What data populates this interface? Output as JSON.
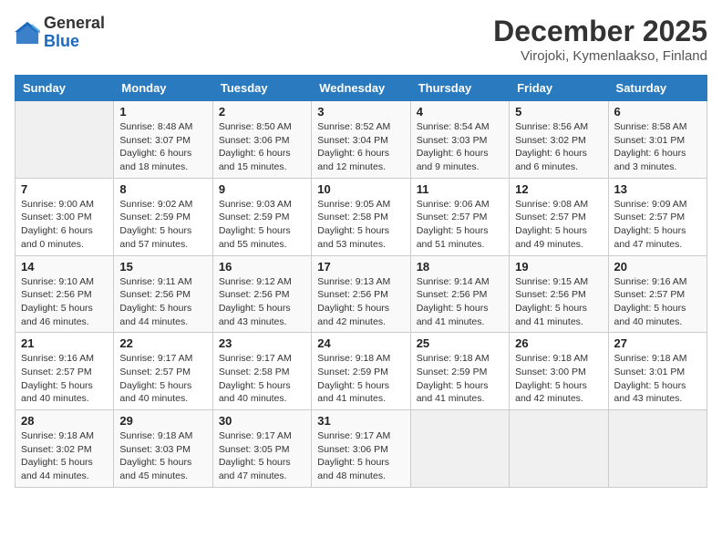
{
  "header": {
    "logo_general": "General",
    "logo_blue": "Blue",
    "month_title": "December 2025",
    "location": "Virojoki, Kymenlaakso, Finland"
  },
  "days_of_week": [
    "Sunday",
    "Monday",
    "Tuesday",
    "Wednesday",
    "Thursday",
    "Friday",
    "Saturday"
  ],
  "weeks": [
    [
      {
        "day": "",
        "info": ""
      },
      {
        "day": "1",
        "info": "Sunrise: 8:48 AM\nSunset: 3:07 PM\nDaylight: 6 hours\nand 18 minutes."
      },
      {
        "day": "2",
        "info": "Sunrise: 8:50 AM\nSunset: 3:06 PM\nDaylight: 6 hours\nand 15 minutes."
      },
      {
        "day": "3",
        "info": "Sunrise: 8:52 AM\nSunset: 3:04 PM\nDaylight: 6 hours\nand 12 minutes."
      },
      {
        "day": "4",
        "info": "Sunrise: 8:54 AM\nSunset: 3:03 PM\nDaylight: 6 hours\nand 9 minutes."
      },
      {
        "day": "5",
        "info": "Sunrise: 8:56 AM\nSunset: 3:02 PM\nDaylight: 6 hours\nand 6 minutes."
      },
      {
        "day": "6",
        "info": "Sunrise: 8:58 AM\nSunset: 3:01 PM\nDaylight: 6 hours\nand 3 minutes."
      }
    ],
    [
      {
        "day": "7",
        "info": "Sunrise: 9:00 AM\nSunset: 3:00 PM\nDaylight: 6 hours\nand 0 minutes."
      },
      {
        "day": "8",
        "info": "Sunrise: 9:02 AM\nSunset: 2:59 PM\nDaylight: 5 hours\nand 57 minutes."
      },
      {
        "day": "9",
        "info": "Sunrise: 9:03 AM\nSunset: 2:59 PM\nDaylight: 5 hours\nand 55 minutes."
      },
      {
        "day": "10",
        "info": "Sunrise: 9:05 AM\nSunset: 2:58 PM\nDaylight: 5 hours\nand 53 minutes."
      },
      {
        "day": "11",
        "info": "Sunrise: 9:06 AM\nSunset: 2:57 PM\nDaylight: 5 hours\nand 51 minutes."
      },
      {
        "day": "12",
        "info": "Sunrise: 9:08 AM\nSunset: 2:57 PM\nDaylight: 5 hours\nand 49 minutes."
      },
      {
        "day": "13",
        "info": "Sunrise: 9:09 AM\nSunset: 2:57 PM\nDaylight: 5 hours\nand 47 minutes."
      }
    ],
    [
      {
        "day": "14",
        "info": "Sunrise: 9:10 AM\nSunset: 2:56 PM\nDaylight: 5 hours\nand 46 minutes."
      },
      {
        "day": "15",
        "info": "Sunrise: 9:11 AM\nSunset: 2:56 PM\nDaylight: 5 hours\nand 44 minutes."
      },
      {
        "day": "16",
        "info": "Sunrise: 9:12 AM\nSunset: 2:56 PM\nDaylight: 5 hours\nand 43 minutes."
      },
      {
        "day": "17",
        "info": "Sunrise: 9:13 AM\nSunset: 2:56 PM\nDaylight: 5 hours\nand 42 minutes."
      },
      {
        "day": "18",
        "info": "Sunrise: 9:14 AM\nSunset: 2:56 PM\nDaylight: 5 hours\nand 41 minutes."
      },
      {
        "day": "19",
        "info": "Sunrise: 9:15 AM\nSunset: 2:56 PM\nDaylight: 5 hours\nand 41 minutes."
      },
      {
        "day": "20",
        "info": "Sunrise: 9:16 AM\nSunset: 2:57 PM\nDaylight: 5 hours\nand 40 minutes."
      }
    ],
    [
      {
        "day": "21",
        "info": "Sunrise: 9:16 AM\nSunset: 2:57 PM\nDaylight: 5 hours\nand 40 minutes."
      },
      {
        "day": "22",
        "info": "Sunrise: 9:17 AM\nSunset: 2:57 PM\nDaylight: 5 hours\nand 40 minutes."
      },
      {
        "day": "23",
        "info": "Sunrise: 9:17 AM\nSunset: 2:58 PM\nDaylight: 5 hours\nand 40 minutes."
      },
      {
        "day": "24",
        "info": "Sunrise: 9:18 AM\nSunset: 2:59 PM\nDaylight: 5 hours\nand 41 minutes."
      },
      {
        "day": "25",
        "info": "Sunrise: 9:18 AM\nSunset: 2:59 PM\nDaylight: 5 hours\nand 41 minutes."
      },
      {
        "day": "26",
        "info": "Sunrise: 9:18 AM\nSunset: 3:00 PM\nDaylight: 5 hours\nand 42 minutes."
      },
      {
        "day": "27",
        "info": "Sunrise: 9:18 AM\nSunset: 3:01 PM\nDaylight: 5 hours\nand 43 minutes."
      }
    ],
    [
      {
        "day": "28",
        "info": "Sunrise: 9:18 AM\nSunset: 3:02 PM\nDaylight: 5 hours\nand 44 minutes."
      },
      {
        "day": "29",
        "info": "Sunrise: 9:18 AM\nSunset: 3:03 PM\nDaylight: 5 hours\nand 45 minutes."
      },
      {
        "day": "30",
        "info": "Sunrise: 9:17 AM\nSunset: 3:05 PM\nDaylight: 5 hours\nand 47 minutes."
      },
      {
        "day": "31",
        "info": "Sunrise: 9:17 AM\nSunset: 3:06 PM\nDaylight: 5 hours\nand 48 minutes."
      },
      {
        "day": "",
        "info": ""
      },
      {
        "day": "",
        "info": ""
      },
      {
        "day": "",
        "info": ""
      }
    ]
  ]
}
